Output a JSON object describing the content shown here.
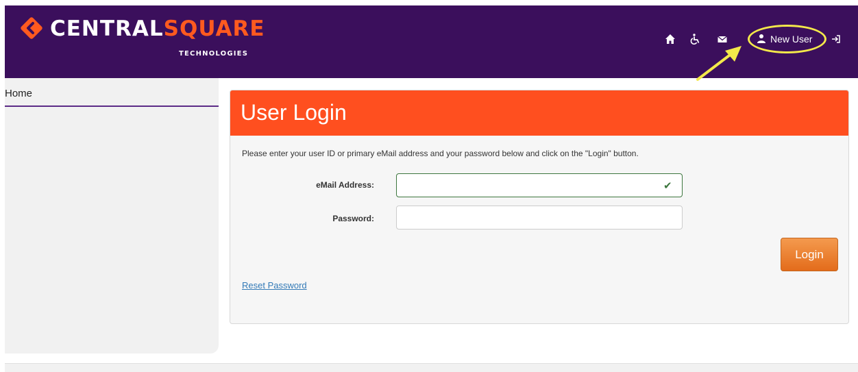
{
  "brand": {
    "name_white": "CENTRAL",
    "name_accent": "SQUARE",
    "subtitle": "TECHNOLOGIES",
    "accent_color": "#ff5a1f",
    "header_color": "#3b0f5c"
  },
  "nav": {
    "icons": [
      "home-icon",
      "accessibility-icon",
      "mail-icon",
      "user-icon",
      "sign-in-icon"
    ],
    "new_user_label": "New User"
  },
  "sidebar": {
    "home_label": "Home"
  },
  "login": {
    "title": "User Login",
    "instructions": "Please enter your user ID or primary eMail address and your password below and click on the \"Login\" button.",
    "email_label": "eMail Address:",
    "email_value": "",
    "password_label": "Password:",
    "password_value": "",
    "login_button": "Login",
    "reset_link": "Reset Password",
    "header_color": "#ff4f1f"
  }
}
